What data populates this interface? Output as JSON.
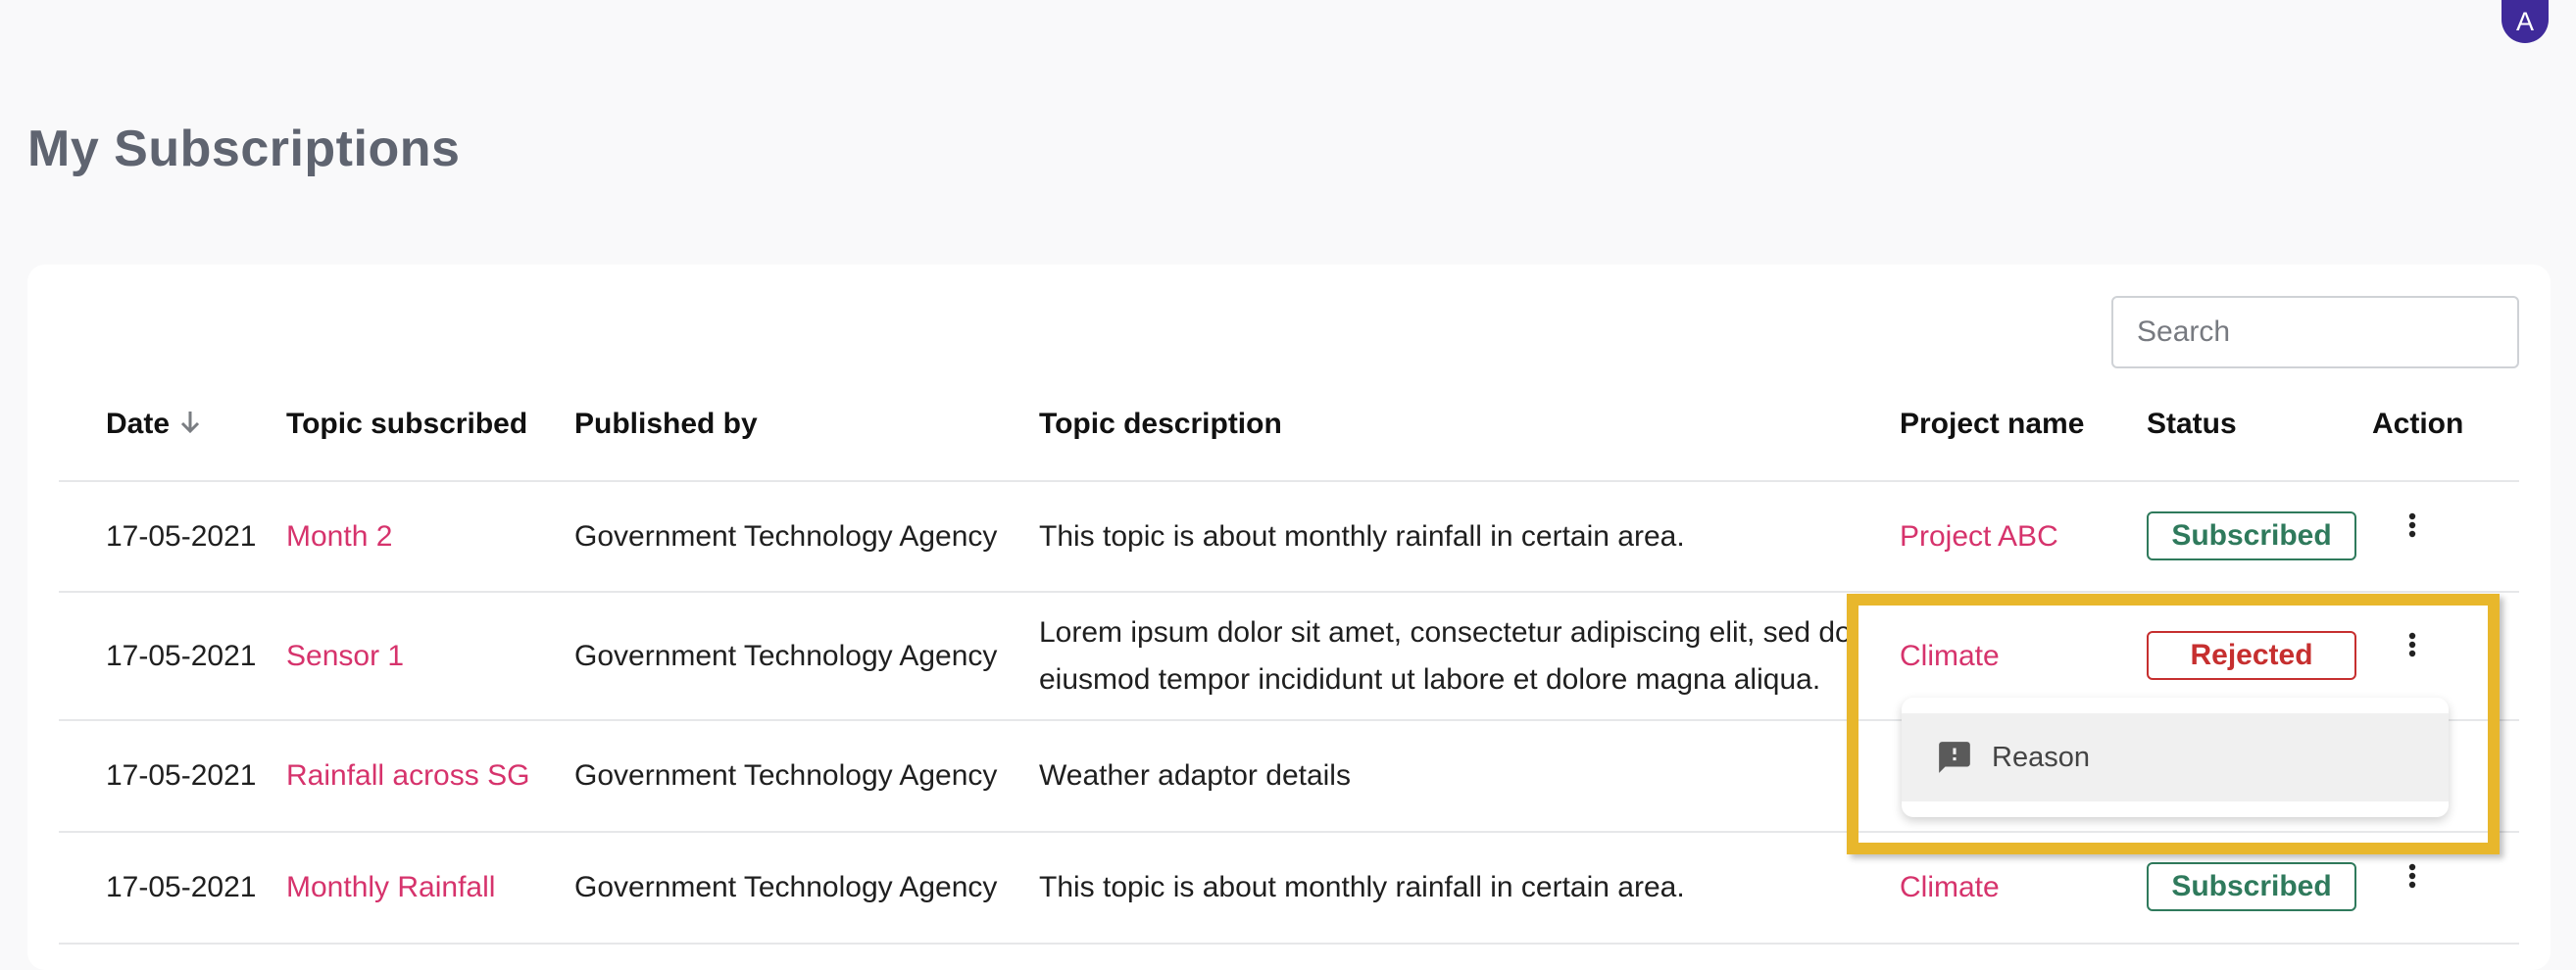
{
  "header": {
    "avatar_initial": "A",
    "page_title": "My Subscriptions"
  },
  "search": {
    "placeholder": "Search"
  },
  "table": {
    "columns": {
      "date": "Date",
      "topic": "Topic subscribed",
      "publisher": "Published by",
      "description": "Topic description",
      "project": "Project name",
      "status": "Status",
      "action": "Action"
    },
    "rows": [
      {
        "date": "17-05-2021",
        "topic": "Month 2",
        "publisher": "Government Technology Agency",
        "description": "This topic is about monthly rainfall in certain area.",
        "project": "Project ABC",
        "status": "Subscribed"
      },
      {
        "date": "17-05-2021",
        "topic": "Sensor 1",
        "publisher": "Government Technology Agency",
        "description_line1": "Lorem ipsum dolor sit amet, consectetur adipiscing elit, sed do",
        "description_line2": "eiusmod tempor incididunt ut labore et dolore magna aliqua.",
        "project": "Climate",
        "status": "Rejected"
      },
      {
        "date": "17-05-2021",
        "topic": "Rainfall across SG",
        "publisher": "Government Technology Agency",
        "description": "Weather adaptor details"
      },
      {
        "date": "17-05-2021",
        "topic": "Monthly Rainfall",
        "publisher": "Government Technology Agency",
        "description": "This topic is about monthly rainfall in certain area.",
        "project": "Climate",
        "status": "Subscribed"
      }
    ]
  },
  "action_menu": {
    "reason_label": "Reason",
    "icon": "feedback-icon"
  },
  "colors": {
    "link": "#d6336c",
    "subscribed": "#2f7a5c",
    "rejected": "#c62f2f",
    "highlight": "#e8b72c",
    "avatar": "#3f2a9a"
  }
}
